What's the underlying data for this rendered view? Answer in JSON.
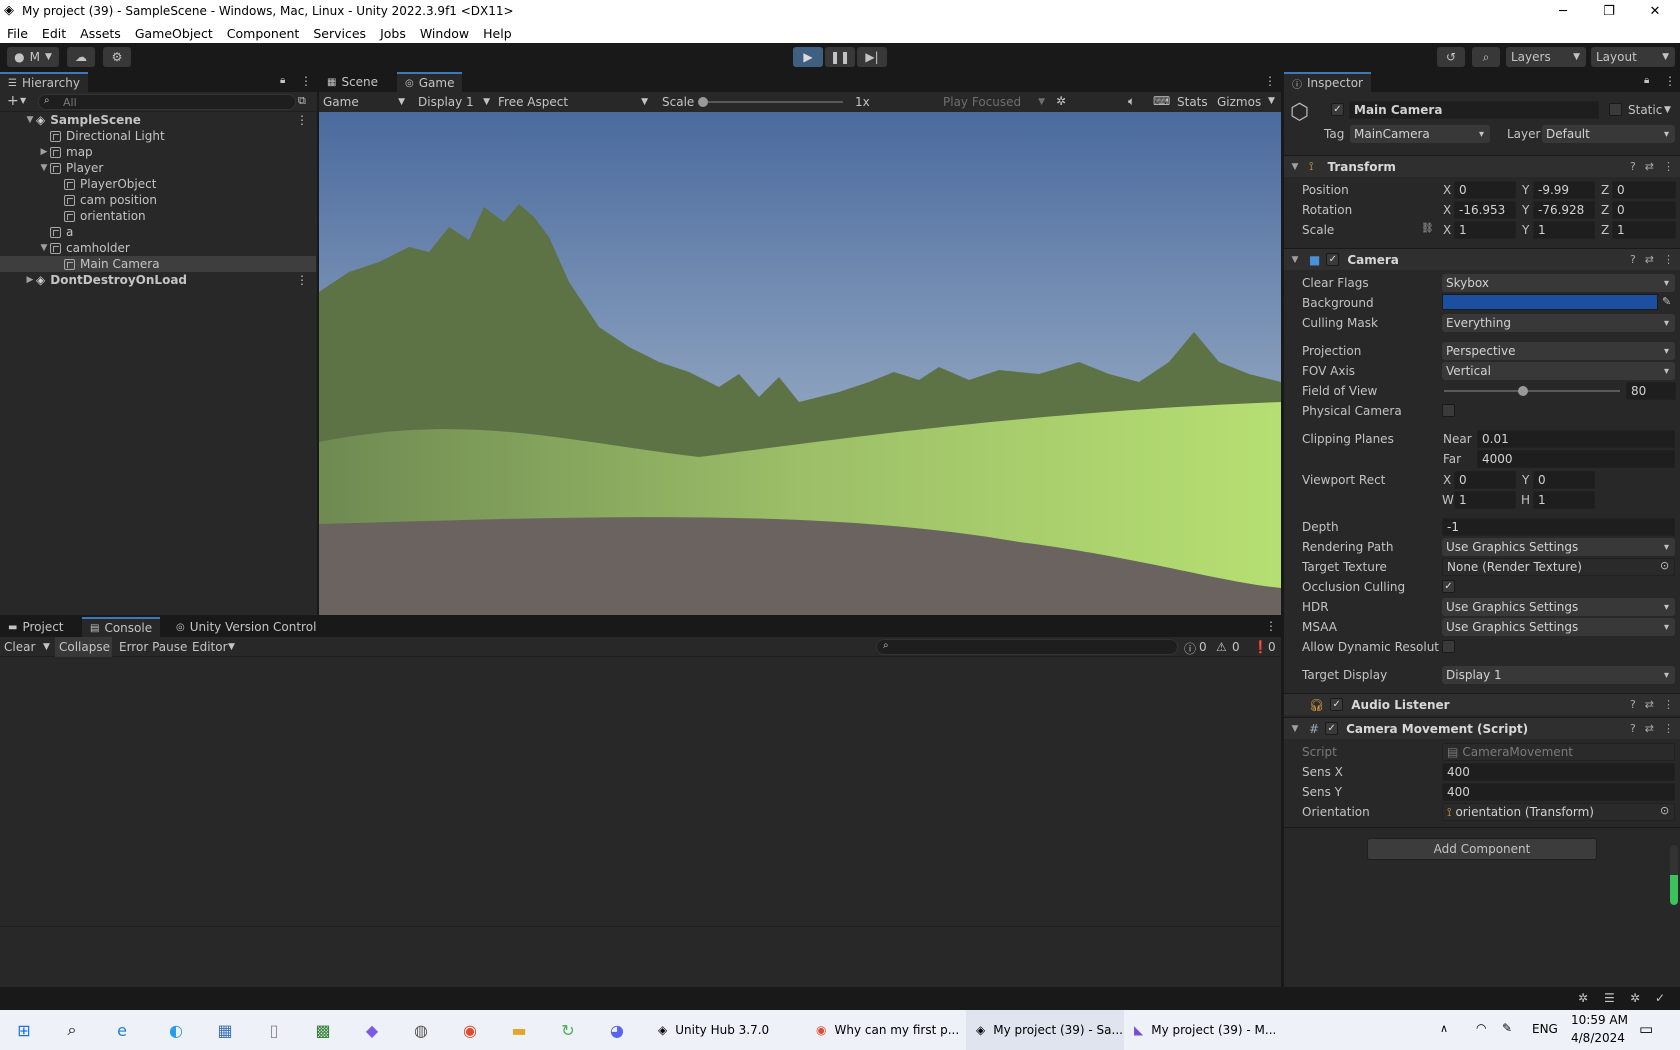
{
  "window": {
    "title": "My project (39) - SampleScene - Windows, Mac, Linux - Unity 2022.3.9f1 <DX11>",
    "minimize": "─",
    "maximize": "❐",
    "close": "✕"
  },
  "menu": [
    "File",
    "Edit",
    "Assets",
    "GameObject",
    "Component",
    "Services",
    "Jobs",
    "Window",
    "Help"
  ],
  "toolbar": {
    "account": "M",
    "layers": "Layers",
    "layout": "Layout"
  },
  "hierarchy": {
    "tab": "Hierarchy",
    "search_placeholder": "All",
    "items": [
      {
        "label": "SampleScene",
        "depth": 0,
        "arrow": "▼",
        "type": "scene"
      },
      {
        "label": "Directional Light",
        "depth": 1,
        "arrow": "",
        "type": "go"
      },
      {
        "label": "map",
        "depth": 1,
        "arrow": "▶",
        "type": "go"
      },
      {
        "label": "Player",
        "depth": 1,
        "arrow": "▼",
        "type": "go"
      },
      {
        "label": "PlayerObject",
        "depth": 2,
        "arrow": "",
        "type": "go"
      },
      {
        "label": "cam position",
        "depth": 2,
        "arrow": "",
        "type": "go"
      },
      {
        "label": "orientation",
        "depth": 2,
        "arrow": "",
        "type": "go"
      },
      {
        "label": "a",
        "depth": 1,
        "arrow": "",
        "type": "go"
      },
      {
        "label": "camholder",
        "depth": 1,
        "arrow": "▼",
        "type": "go"
      },
      {
        "label": "Main Camera",
        "depth": 2,
        "arrow": "",
        "type": "go",
        "selected": true
      },
      {
        "label": "DontDestroyOnLoad",
        "depth": 0,
        "arrow": "▶",
        "type": "scene"
      }
    ]
  },
  "scene_tabs": {
    "scene": "Scene",
    "game": "Game"
  },
  "game_toolbar": {
    "view": "Game",
    "display": "Display 1",
    "aspect": "Free Aspect",
    "scale_label": "Scale",
    "scale_value": "1x",
    "play_mode": "Play Focused",
    "stats": "Stats",
    "gizmos": "Gizmos"
  },
  "bottom": {
    "tabs": {
      "project": "Project",
      "console": "Console",
      "vcs": "Unity Version Control"
    },
    "clear": "Clear",
    "collapse": "Collapse",
    "error_pause": "Error Pause",
    "editor": "Editor",
    "count_log": "0",
    "count_warn": "0",
    "count_err": "0"
  },
  "inspector": {
    "tab": "Inspector",
    "object_name": "Main Camera",
    "static": "Static",
    "tag_label": "Tag",
    "tag_value": "MainCamera",
    "layer_label": "Layer",
    "layer_value": "Default",
    "transform": {
      "title": "Transform",
      "position_label": "Position",
      "rotation_label": "Rotation",
      "scale_label": "Scale",
      "position": {
        "x": "0",
        "y": "-9.99",
        "z": "0"
      },
      "rotation": {
        "x": "-16.953",
        "y": "-76.928",
        "z": "0"
      },
      "scale": {
        "x": "1",
        "y": "1",
        "z": "1"
      }
    },
    "camera": {
      "title": "Camera",
      "clear_flags_label": "Clear Flags",
      "clear_flags": "Skybox",
      "background_label": "Background",
      "background_color": "#1d4fa1",
      "culling_mask_label": "Culling Mask",
      "culling_mask": "Everything",
      "projection_label": "Projection",
      "projection": "Perspective",
      "fov_axis_label": "FOV Axis",
      "fov_axis": "Vertical",
      "fov_label": "Field of View",
      "fov": "80",
      "physical_label": "Physical Camera",
      "clipping_label": "Clipping Planes",
      "near_label": "Near",
      "near": "0.01",
      "far_label": "Far",
      "far": "4000",
      "viewport_label": "Viewport Rect",
      "vx": "0",
      "vy": "0",
      "vw": "1",
      "vh": "1",
      "depth_label": "Depth",
      "depth": "-1",
      "rendering_path_label": "Rendering Path",
      "rendering_path": "Use Graphics Settings",
      "target_texture_label": "Target Texture",
      "target_texture": "None (Render Texture)",
      "occlusion_label": "Occlusion Culling",
      "hdr_label": "HDR",
      "hdr": "Use Graphics Settings",
      "msaa_label": "MSAA",
      "msaa": "Use Graphics Settings",
      "dynres_label": "Allow Dynamic Resolutic",
      "target_display_label": "Target Display",
      "target_display": "Display 1"
    },
    "audio_listener": {
      "title": "Audio Listener"
    },
    "camera_movement": {
      "title": "Camera Movement (Script)",
      "script_label": "Script",
      "script": "CameraMovement",
      "sensx_label": "Sens X",
      "sensx": "400",
      "sensy_label": "Sens Y",
      "sensy": "400",
      "orientation_label": "Orientation",
      "orientation": "orientation (Transform)"
    },
    "add_component": "Add Component"
  },
  "taskbar": {
    "apps": [
      {
        "label": "Unity Hub 3.7.0"
      },
      {
        "label": "Why can my first p..."
      },
      {
        "label": "My project (39) - Sa..."
      },
      {
        "label": "My project (39) - M..."
      }
    ],
    "lang": "ENG",
    "time": "10:59 AM",
    "date": "4/8/2024"
  }
}
